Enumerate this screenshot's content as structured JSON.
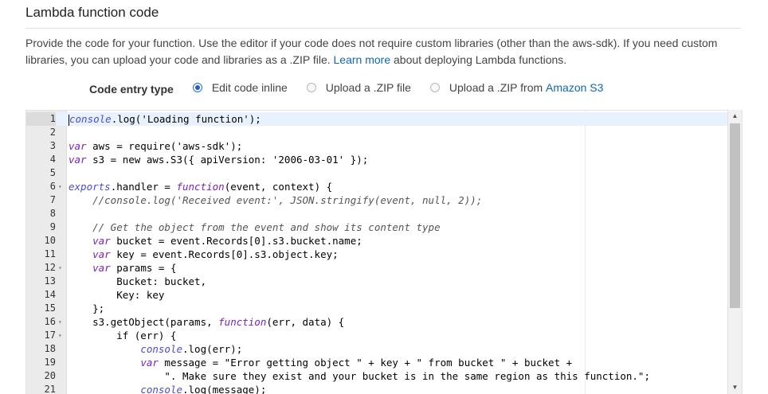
{
  "section": {
    "title": "Lambda function code"
  },
  "description": {
    "text_before_link": "Provide the code for your function. Use the editor if your code does not require custom libraries (other than the aws-sdk). If you need custom libraries, you can upload your code and libraries as a .ZIP file. ",
    "link_text": "Learn more",
    "text_after_link": " about deploying Lambda functions."
  },
  "code_entry": {
    "label": "Code entry type",
    "options": [
      {
        "label": "Edit code inline",
        "selected": true
      },
      {
        "label": "Upload a .ZIP file",
        "selected": false
      },
      {
        "label": "Upload a .ZIP from ",
        "link": "Amazon S3",
        "selected": false
      }
    ]
  },
  "editor": {
    "active_line": 1,
    "lines": [
      {
        "num": "1",
        "fold": false,
        "tokens": [
          [
            "fn",
            "console"
          ],
          [
            "plain",
            ".log('Loading function');"
          ]
        ]
      },
      {
        "num": "2",
        "fold": false,
        "tokens": []
      },
      {
        "num": "3",
        "fold": false,
        "tokens": [
          [
            "kw",
            "var"
          ],
          [
            "plain",
            " aws = require('aws-sdk');"
          ]
        ]
      },
      {
        "num": "4",
        "fold": false,
        "tokens": [
          [
            "kw",
            "var"
          ],
          [
            "plain",
            " s3 = new aws.S3({ apiVersion: '2006-03-01' });"
          ]
        ]
      },
      {
        "num": "5",
        "fold": false,
        "tokens": []
      },
      {
        "num": "6",
        "fold": true,
        "tokens": [
          [
            "fn",
            "exports"
          ],
          [
            "plain",
            ".handler = "
          ],
          [
            "kw",
            "function"
          ],
          [
            "plain",
            "(event, context) {"
          ]
        ]
      },
      {
        "num": "7",
        "fold": false,
        "tokens": [
          [
            "plain",
            "    "
          ],
          [
            "cmt",
            "//console.log('Received event:', JSON.stringify(event, null, 2));"
          ]
        ]
      },
      {
        "num": "8",
        "fold": false,
        "tokens": []
      },
      {
        "num": "9",
        "fold": false,
        "tokens": [
          [
            "plain",
            "    "
          ],
          [
            "cmt",
            "// Get the object from the event and show its content type"
          ]
        ]
      },
      {
        "num": "10",
        "fold": false,
        "tokens": [
          [
            "plain",
            "    "
          ],
          [
            "kw",
            "var"
          ],
          [
            "plain",
            " bucket = event.Records[0].s3.bucket.name;"
          ]
        ]
      },
      {
        "num": "11",
        "fold": false,
        "tokens": [
          [
            "plain",
            "    "
          ],
          [
            "kw",
            "var"
          ],
          [
            "plain",
            " key = event.Records[0].s3.object.key;"
          ]
        ]
      },
      {
        "num": "12",
        "fold": true,
        "tokens": [
          [
            "plain",
            "    "
          ],
          [
            "kw",
            "var"
          ],
          [
            "plain",
            " params = {"
          ]
        ]
      },
      {
        "num": "13",
        "fold": false,
        "tokens": [
          [
            "plain",
            "        Bucket: bucket,"
          ]
        ]
      },
      {
        "num": "14",
        "fold": false,
        "tokens": [
          [
            "plain",
            "        Key: key"
          ]
        ]
      },
      {
        "num": "15",
        "fold": false,
        "tokens": [
          [
            "plain",
            "    };"
          ]
        ]
      },
      {
        "num": "16",
        "fold": true,
        "tokens": [
          [
            "plain",
            "    s3.getObject(params, "
          ],
          [
            "kw",
            "function"
          ],
          [
            "plain",
            "(err, data) {"
          ]
        ]
      },
      {
        "num": "17",
        "fold": true,
        "tokens": [
          [
            "plain",
            "        if (err) {"
          ]
        ]
      },
      {
        "num": "18",
        "fold": false,
        "tokens": [
          [
            "plain",
            "            "
          ],
          [
            "fn",
            "console"
          ],
          [
            "plain",
            ".log(err);"
          ]
        ]
      },
      {
        "num": "19",
        "fold": false,
        "tokens": [
          [
            "plain",
            "            "
          ],
          [
            "kw",
            "var"
          ],
          [
            "plain",
            " message = \"Error getting object \" + key + \" from bucket \" + bucket +"
          ]
        ]
      },
      {
        "num": "20",
        "fold": false,
        "tokens": [
          [
            "plain",
            "                \". Make sure they exist and your bucket is in the same region as this function.\";"
          ]
        ]
      },
      {
        "num": "21",
        "fold": false,
        "tokens": [
          [
            "plain",
            "            "
          ],
          [
            "fn",
            "console"
          ],
          [
            "plain",
            ".log(message);"
          ]
        ]
      }
    ]
  },
  "scrollbar": {
    "up_glyph": "▲",
    "down_glyph": "▼"
  },
  "colors": {
    "link": "#1166bb",
    "radio_selected": "#1d5fcf",
    "keyword": "#7a22bb",
    "gutter": "#ebebeb",
    "active_line": "#e8f2ff"
  }
}
